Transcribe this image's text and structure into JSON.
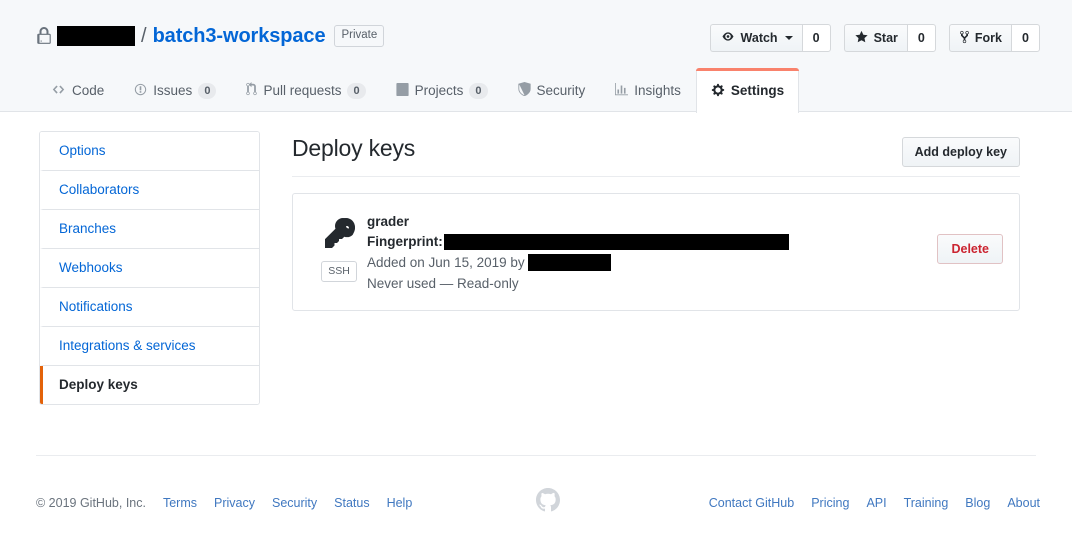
{
  "repo": {
    "owner_redacted": true,
    "separator": "/",
    "name": "batch3-workspace",
    "visibility_badge": "Private",
    "lock_icon": "lock-icon"
  },
  "repo_actions": [
    {
      "icon": "eye-icon",
      "label": "Watch",
      "has_caret": true,
      "count": "0"
    },
    {
      "icon": "star-icon",
      "label": "Star",
      "has_caret": false,
      "count": "0"
    },
    {
      "icon": "repo-forked-icon",
      "label": "Fork",
      "has_caret": false,
      "count": "0"
    }
  ],
  "nav_tabs": [
    {
      "icon": "code-icon",
      "label": "Code",
      "count": null,
      "active": false
    },
    {
      "icon": "issue-opened-icon",
      "label": "Issues",
      "count": "0",
      "active": false
    },
    {
      "icon": "git-pull-request-icon",
      "label": "Pull requests",
      "count": "0",
      "active": false
    },
    {
      "icon": "project-icon",
      "label": "Projects",
      "count": "0",
      "active": false
    },
    {
      "icon": "shield-icon",
      "label": "Security",
      "count": null,
      "active": false
    },
    {
      "icon": "graph-icon",
      "label": "Insights",
      "count": null,
      "active": false
    },
    {
      "icon": "gear-icon",
      "label": "Settings",
      "count": null,
      "active": true
    }
  ],
  "sidebar": {
    "items": [
      {
        "label": "Options",
        "active": false
      },
      {
        "label": "Collaborators",
        "active": false
      },
      {
        "label": "Branches",
        "active": false
      },
      {
        "label": "Webhooks",
        "active": false
      },
      {
        "label": "Notifications",
        "active": false
      },
      {
        "label": "Integrations & services",
        "active": false
      },
      {
        "label": "Deploy keys",
        "active": true
      }
    ]
  },
  "main": {
    "page_title": "Deploy keys",
    "add_button_label": "Add deploy key",
    "deploy_keys": [
      {
        "icon": "key-icon",
        "type_badge": "SSH",
        "title": "grader",
        "fingerprint_label": "Fingerprint:",
        "fingerprint_value_redacted": true,
        "added_prefix": "Added on Jun 15, 2019 by",
        "added_by_redacted": true,
        "usage_status": "Never used — Read-only",
        "delete_label": "Delete"
      }
    ]
  },
  "footer": {
    "copyright": "© 2019 GitHub, Inc.",
    "left_links": [
      "Terms",
      "Privacy",
      "Security",
      "Status",
      "Help"
    ],
    "mark_icon": "github-mark-icon",
    "right_links": [
      "Contact GitHub",
      "Pricing",
      "API",
      "Training",
      "Blog",
      "About"
    ]
  },
  "colors": {
    "accent_blue": "#0366d6",
    "link_blue": "#4078c0",
    "active_tab_orange": "#f9826c",
    "sidebar_active_orange": "#e36209",
    "danger_red": "#cb2431",
    "header_bg": "#f6f8fa",
    "border": "#e1e4e8",
    "muted_text": "#586069"
  }
}
